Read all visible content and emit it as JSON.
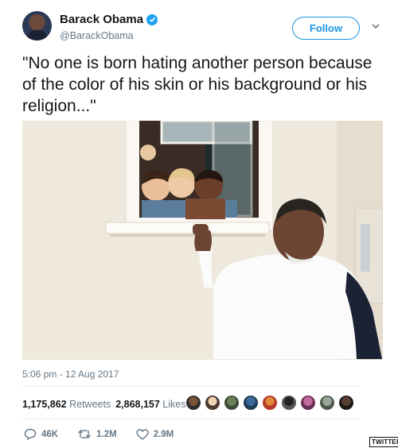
{
  "header": {
    "name": "Barack Obama",
    "handle": "@BarackObama",
    "follow_label": "Follow"
  },
  "tweet": {
    "text": "\"No one is born hating another person because of the color of his skin or his background or his religion...\"",
    "timestamp": "5:06 pm - 12 Aug 2017"
  },
  "stats": {
    "retweets_count": "1,175,862",
    "retweets_label": "Retweets",
    "likes_count": "2,868,157",
    "likes_label": "Likes"
  },
  "actions": {
    "replies": "46K",
    "retweets": "1.2M",
    "likes": "2.9M"
  },
  "watermark": "TWITTER",
  "colors": {
    "accent": "#1b95e0",
    "verified": "#1da1f2",
    "secondary_text": "#657786"
  },
  "icons": {
    "verified": "verified-badge-icon",
    "chevron": "chevron-down-icon",
    "reply": "reply-icon",
    "retweet": "retweet-icon",
    "like": "heart-icon"
  }
}
